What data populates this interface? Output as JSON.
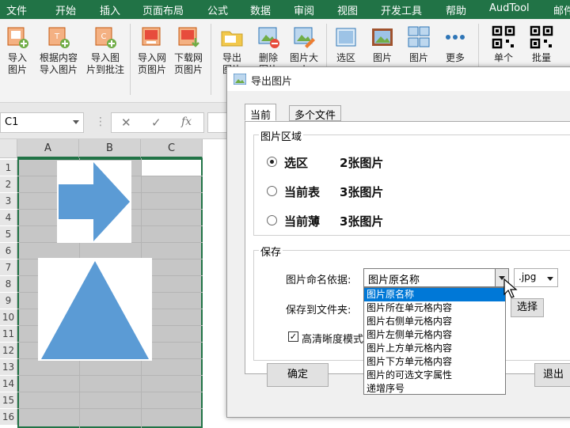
{
  "menubar": {
    "items": [
      "文件",
      "开始",
      "插入",
      "页面布局",
      "公式",
      "数据",
      "审阅",
      "视图",
      "开发工具",
      "帮助",
      "AudTool",
      "邮件"
    ]
  },
  "ribbon": {
    "buttons": [
      "导入\n图片",
      "根据内容\n导入图片",
      "导入图\n片到批注",
      "导入网\n页图片",
      "下载网\n页图片",
      "导出\n图片",
      "删除\n图片",
      "图片大\n小",
      "选区",
      "图片",
      "图片",
      "更多",
      "单个",
      "批量"
    ]
  },
  "formula_bar": {
    "name_box": "C1",
    "cancel_icon": "✕",
    "enter_icon": "✓",
    "fx_icon": "fx"
  },
  "sheet": {
    "columns": [
      "A",
      "B",
      "C"
    ],
    "rows": [
      "1",
      "2",
      "3",
      "4",
      "5",
      "6",
      "7",
      "8",
      "9",
      "10",
      "11",
      "12",
      "13",
      "14",
      "15",
      "16"
    ]
  },
  "dialog": {
    "title": "导出图片",
    "tabs": [
      "当前",
      "多个文件"
    ],
    "picture_area": {
      "title": "图片区域",
      "options": [
        {
          "label": "选区",
          "count": "2张图片",
          "selected": true
        },
        {
          "label": "当前表",
          "count": "3张图片",
          "selected": false
        },
        {
          "label": "当前薄",
          "count": "3张图片",
          "selected": false
        }
      ]
    },
    "save": {
      "title": "保存",
      "naming_label": "图片命名依据:",
      "naming_value": "图片原名称",
      "extension": ".jpg",
      "folder_label": "保存到文件夹:",
      "choose_button": "选择",
      "hd_label": "高清晰度模式",
      "hd_checked": true,
      "dropdown_options": [
        "图片原名称",
        "图片所在单元格内容",
        "图片右侧单元格内容",
        "图片左侧单元格内容",
        "图片上方单元格内容",
        "图片下方单元格内容",
        "图片的可选文字属性",
        "递增序号"
      ]
    },
    "ok_button": "确定",
    "exit_button": "退出"
  },
  "colors": {
    "excel_green": "#217346",
    "shape_blue": "#5b9bd5",
    "selection_blue": "#0078d7"
  }
}
